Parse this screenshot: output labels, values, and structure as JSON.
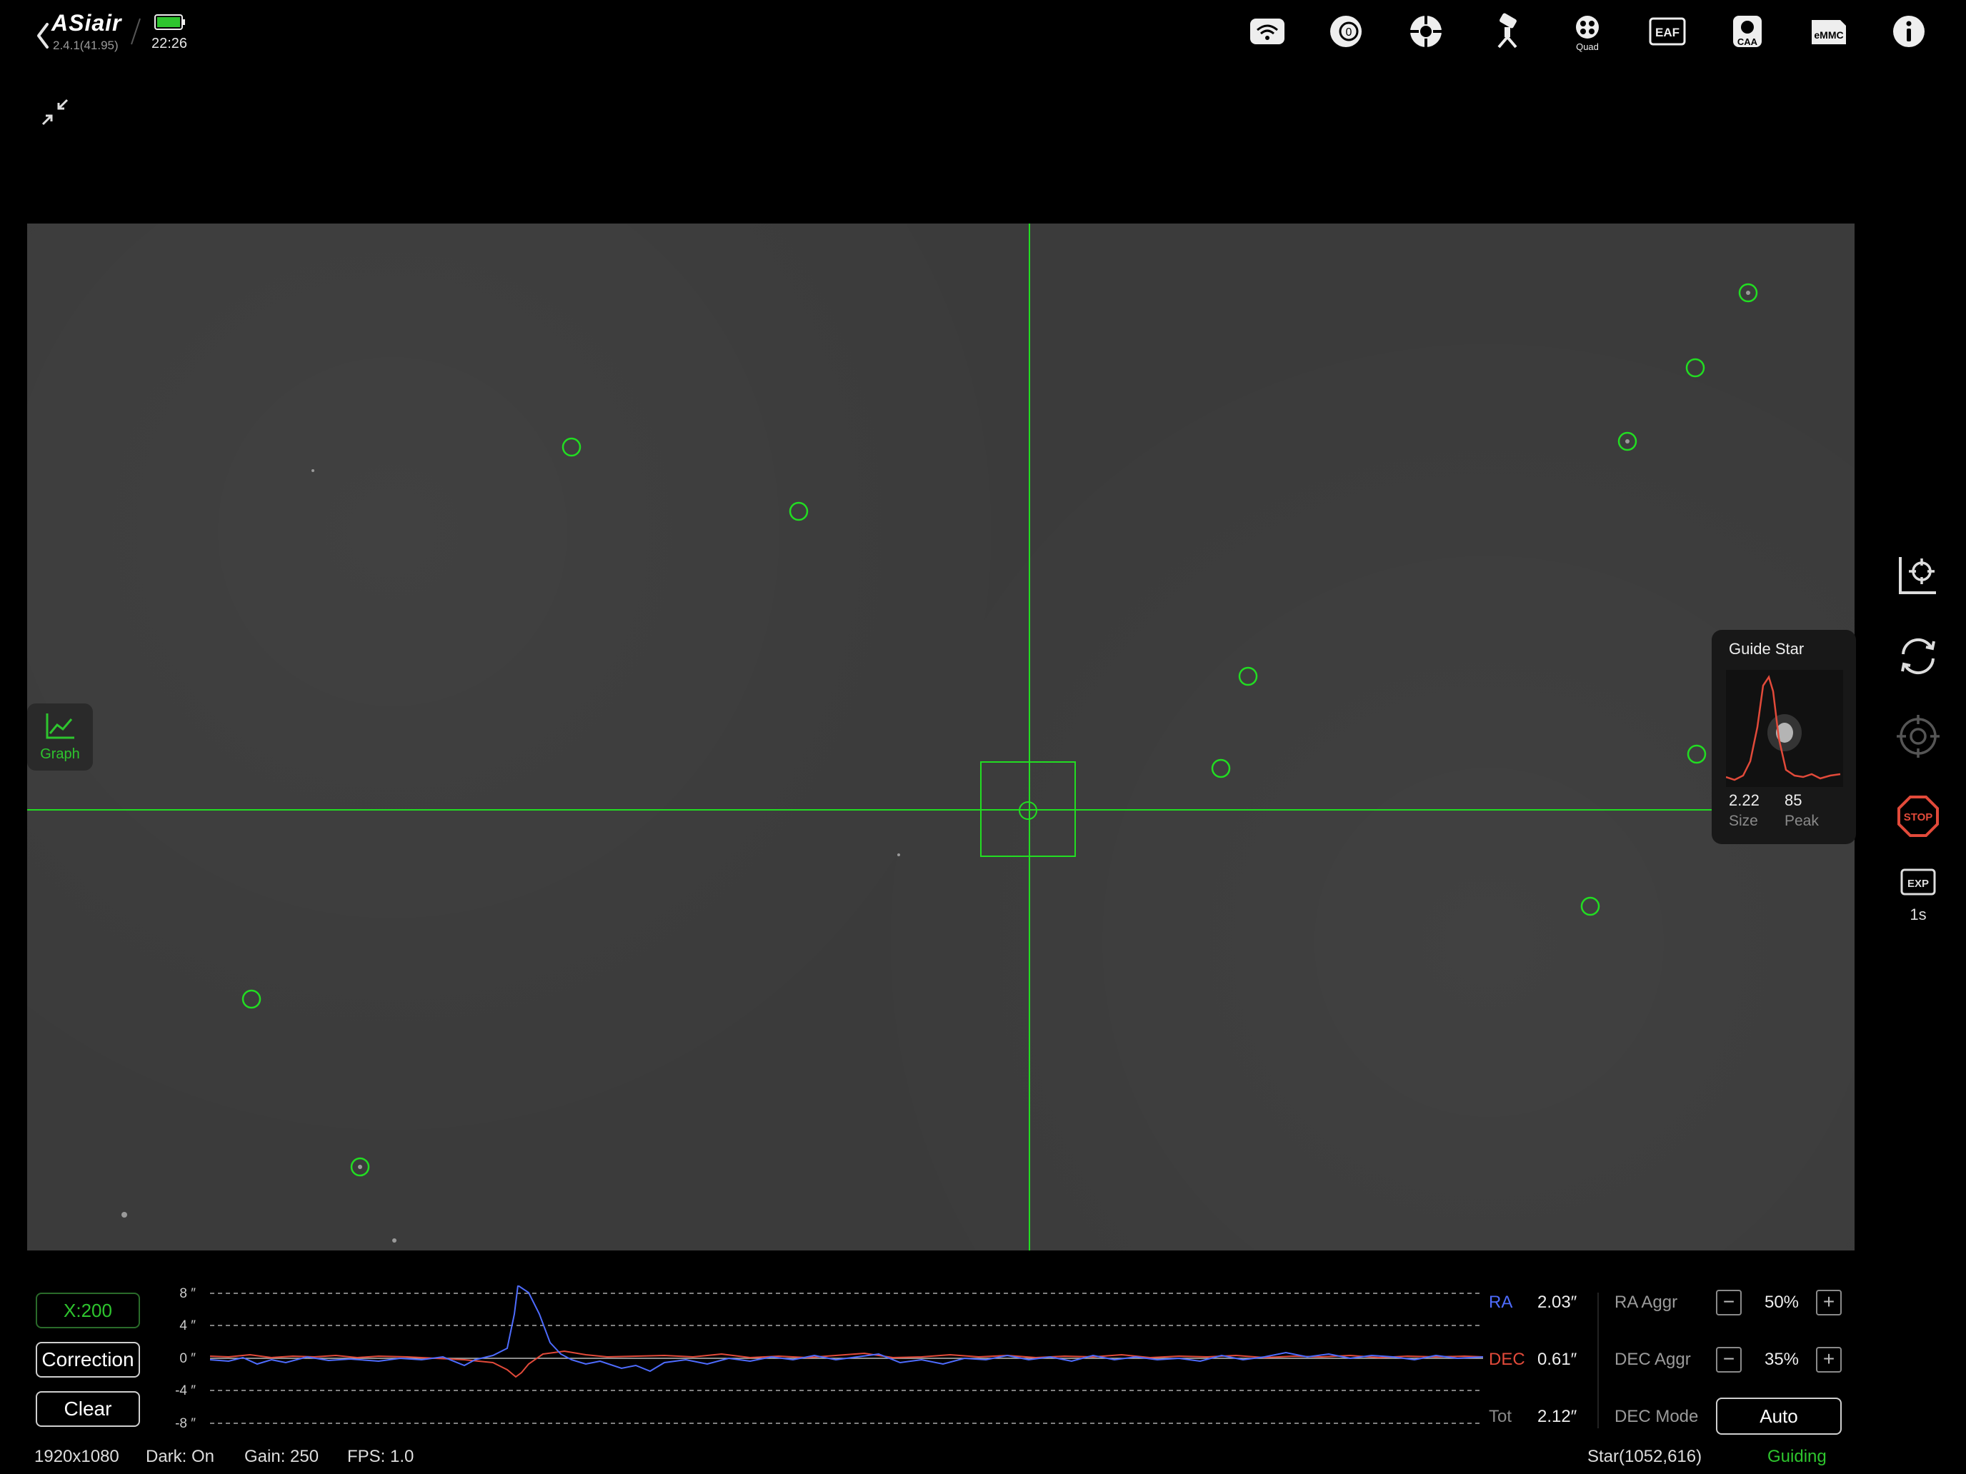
{
  "app": {
    "logo": "ASiair",
    "version": "2.4.1(41.95)",
    "time": "22:26"
  },
  "top_icons": [
    "wifi-icon",
    "camera-icon",
    "guide-icon",
    "mount-icon",
    "quad-filter-icon",
    "eaf-icon",
    "caa-icon",
    "emmc-icon",
    "info-icon"
  ],
  "top_icon_labels": {
    "quad": "Quad",
    "eaf": "EAF",
    "caa": "CAA",
    "emmc": "eMMC"
  },
  "graph_button": {
    "label": "Graph"
  },
  "guide_star": {
    "title": "Guide Star",
    "size": "2.22",
    "size_label": "Size",
    "peak": "85",
    "peak_label": "Peak"
  },
  "right_toolbar": {
    "stop_label": "STOP",
    "exp_label": "EXP",
    "exp_value": "1s"
  },
  "bottom": {
    "zoom": "X:200",
    "correction": "Correction",
    "clear": "Clear",
    "y_ticks": [
      "8 ″",
      "4 ″",
      "0 ″",
      "-4 ″",
      "-8 ″"
    ],
    "ra_label": "RA",
    "ra_value": "2.03″",
    "dec_label": "DEC",
    "dec_value": "0.61″",
    "tot_label": "Tot",
    "tot_value": "2.12″",
    "ra_aggr_label": "RA Aggr",
    "ra_aggr_value": "50%",
    "dec_aggr_label": "DEC Aggr",
    "dec_aggr_value": "35%",
    "dec_mode_label": "DEC Mode",
    "dec_mode_value": "Auto",
    "minus": "−",
    "plus": "+"
  },
  "status": {
    "resolution": "1920x1080",
    "dark": "Dark: On",
    "gain": "Gain: 250",
    "fps": "FPS: 1.0",
    "star": "Star(1052,616)",
    "state": "Guiding"
  },
  "colors": {
    "accent_green": "#2ec52e",
    "ra_blue": "#4e6cff",
    "dec_red": "#e24a3a",
    "stop_red": "#e24a3a"
  }
}
